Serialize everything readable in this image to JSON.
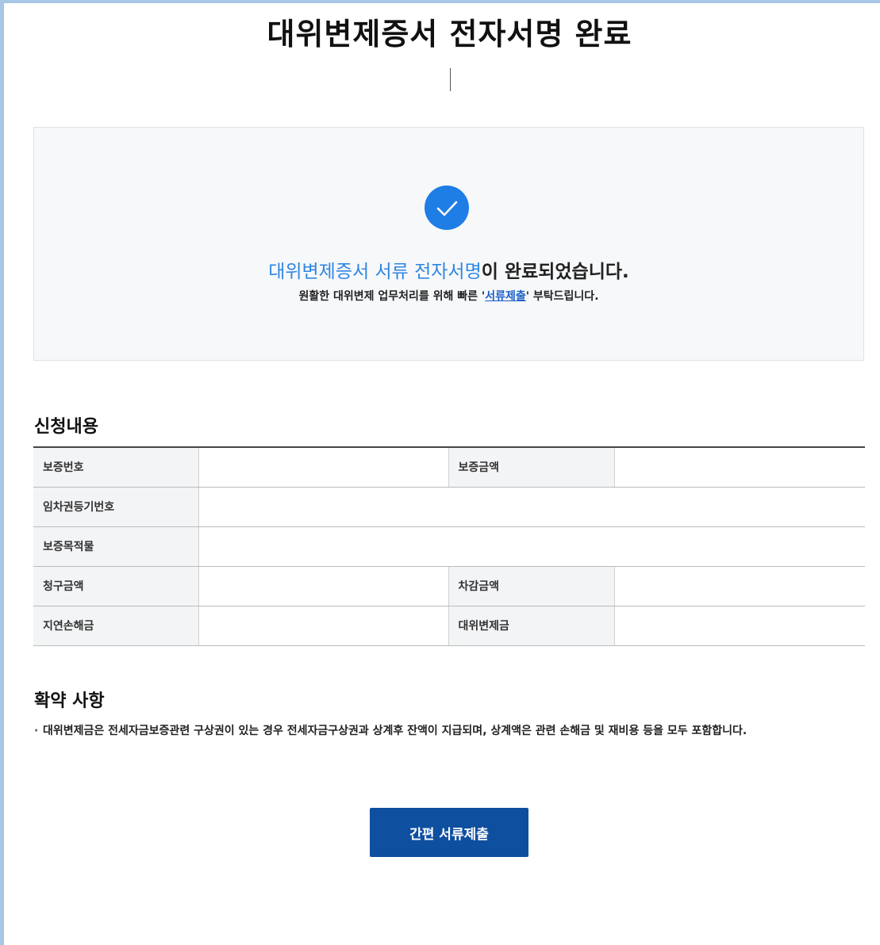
{
  "page_title": "대위변제증서 전자서명 완료",
  "completion": {
    "highlight": "대위변제증서 서류 전자서명",
    "message_suffix": "이 완료되었습니다.",
    "sub_prefix": "원활한 대위변제 업무처리를 위해 빠른 '",
    "sub_link": "서류제출",
    "sub_suffix": "' 부탁드립니다."
  },
  "application": {
    "title": "신청내용",
    "labels": {
      "guarantee_no": "보증번호",
      "guarantee_amount": "보증금액",
      "lease_registration_no": "임차권등기번호",
      "guarantee_property": "보증목적물",
      "claim_amount": "청구금액",
      "deduction_amount": "차감금액",
      "late_damages": "지연손해금",
      "subrogation_amount": "대위변제금"
    }
  },
  "agreement": {
    "title": "확약 사항",
    "bullet": "·",
    "text": "대위변제금은 전세자금보증관련 구상권이 있는 경우 전세자금구상권과 상계후 잔액이 지급되며, 상계액은 관련 손해금 및 재비용 등을 모두 포함합니다."
  },
  "submit_button": "간편 서류제출"
}
